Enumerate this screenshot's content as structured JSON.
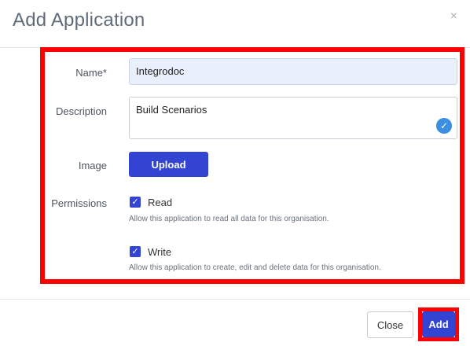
{
  "dialog": {
    "title": "Add Application",
    "close_glyph": "×"
  },
  "form": {
    "name_label": "Name*",
    "name_value": "Integrodoc",
    "description_label": "Description",
    "description_value": "Build Scenarios",
    "image_label": "Image",
    "upload_label": "Upload",
    "permissions_label": "Permissions",
    "permissions": [
      {
        "label": "Read",
        "checked": true,
        "help": "Allow this application to read all data for this organisation."
      },
      {
        "label": "Write",
        "checked": true,
        "help": "Allow this application to create, edit and delete data for this organisation."
      }
    ]
  },
  "footer": {
    "close_label": "Close",
    "add_label": "Add"
  },
  "colors": {
    "primary": "#3244d1",
    "highlight": "#ff0000",
    "input_fill": "#e9f0fb"
  }
}
